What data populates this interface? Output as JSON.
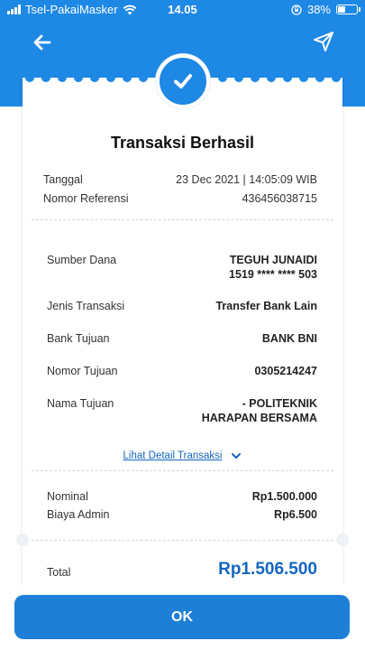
{
  "status_bar": {
    "carrier": "Tsel-PakaiMasker",
    "time": "14.05",
    "battery": "38%",
    "icons": [
      "signal-icon",
      "wifi-icon",
      "orientation-lock-icon",
      "battery-icon"
    ]
  },
  "nav": {
    "back_icon": "arrow-left-icon",
    "share_icon": "send-icon"
  },
  "colors": {
    "header": "#1e88e5",
    "accent": "#1565c0",
    "button": "#1e7fd6"
  },
  "receipt": {
    "status_icon": "check-icon",
    "title": "Transaksi Berhasil",
    "meta": [
      {
        "label": "Tanggal",
        "value": "23 Dec 2021 | 14:05:09 WIB"
      },
      {
        "label": "Nomor Referensi",
        "value": "436456038715"
      }
    ],
    "details": [
      {
        "label": "Sumber Dana",
        "value_line1": "TEGUH JUNAIDI",
        "value_line2": "1519 **** **** 503"
      },
      {
        "label": "Jenis Transaksi",
        "value_line1": "Transfer Bank Lain"
      },
      {
        "label": "Bank Tujuan",
        "value_line1": "BANK BNI"
      },
      {
        "label": "Nomor Tujuan",
        "value_line1": "0305214247"
      },
      {
        "label": "Nama Tujuan",
        "value_line1": "-  POLITEKNIK",
        "value_line2": "HARAPAN BERSAMA"
      }
    ],
    "detail_link": "Lihat Detail Transaksi",
    "amounts": [
      {
        "label": "Nominal",
        "value": "Rp1.500.000"
      },
      {
        "label": "Biaya Admin",
        "value": "Rp6.500"
      }
    ],
    "total_label": "Total",
    "total_value": "Rp1.506.500"
  },
  "ok_button": "OK"
}
